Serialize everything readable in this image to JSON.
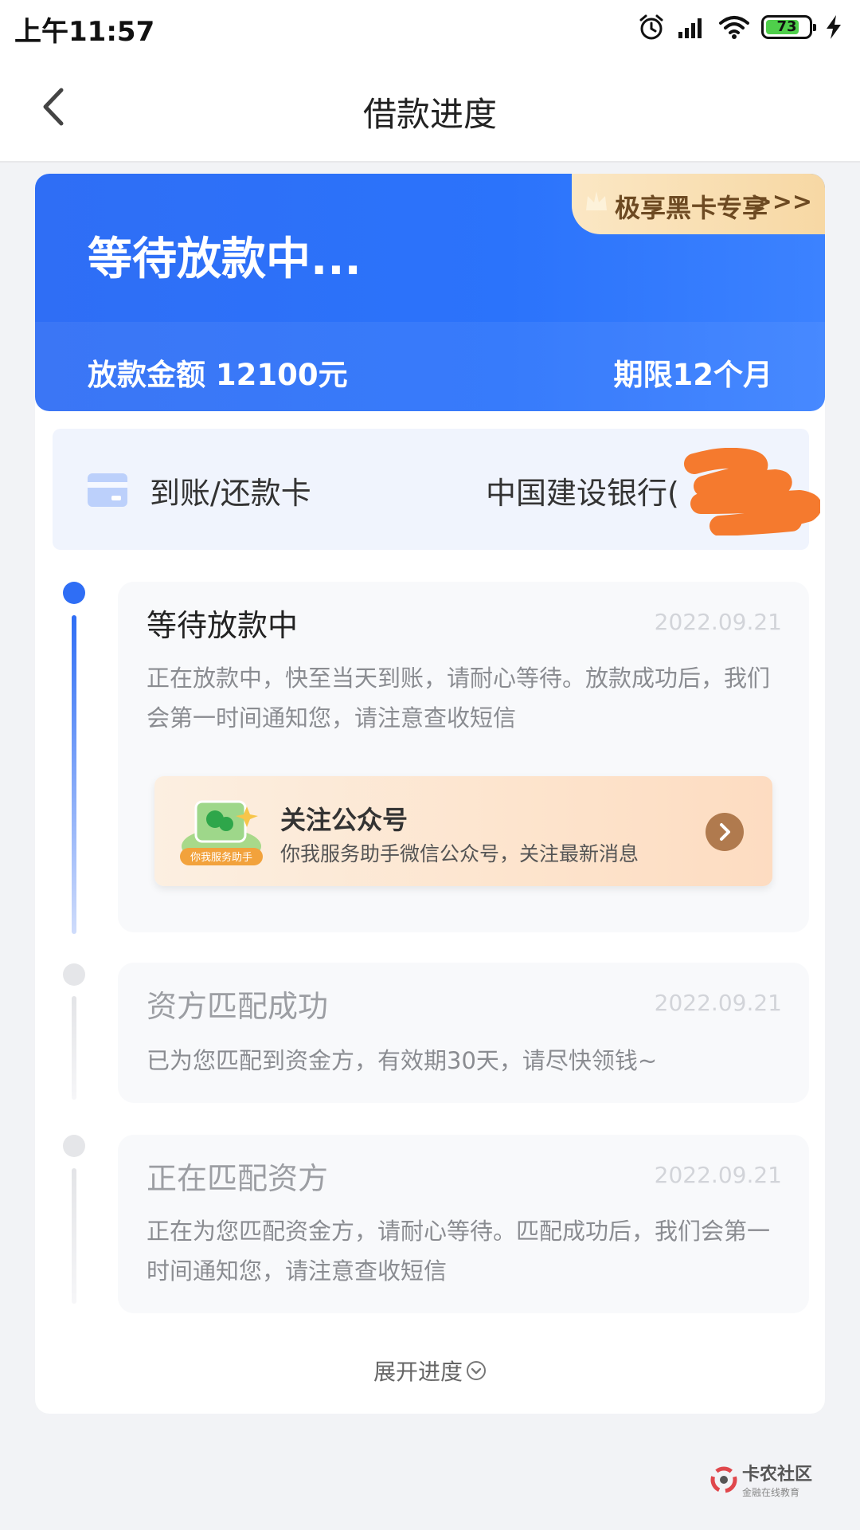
{
  "status_bar": {
    "time": "上午11:57",
    "battery": "73"
  },
  "nav": {
    "title": "借款进度"
  },
  "hero": {
    "status": "等待放款中...",
    "amount_text": "放款金额 12100元",
    "term_text": "期限12个月",
    "vip_tag": "极享黑卡专享",
    "vip_arrows": ">>>"
  },
  "card": {
    "label": "到账/还款卡",
    "bank": "中国建设银行("
  },
  "steps": [
    {
      "title": "等待放款中",
      "date": "2022.09.21",
      "desc": "正在放款中，快至当天到账，请耐心等待。放款成功后，我们会第一时间通知您，请注意查收短信",
      "active": true
    },
    {
      "title": "资方匹配成功",
      "date": "2022.09.21",
      "desc": "已为您匹配到资金方，有效期30天，请尽快领钱~",
      "active": false
    },
    {
      "title": "正在匹配资方",
      "date": "2022.09.21",
      "desc": "正在为您匹配资金方，请耐心等待。匹配成功后，我们会第一时间通知您，请注意查收短信",
      "active": false
    }
  ],
  "promo": {
    "title": "关注公众号",
    "subtitle": "你我服务助手微信公众号，关注最新消息",
    "badge": "你我服务助手"
  },
  "expand_label": "展开进度",
  "watermark": {
    "title": "卡农社区",
    "subtitle": "金融在线教育"
  },
  "colors": {
    "primary": "#2f6ef5",
    "vip_bg": "#f7d8a4",
    "redaction": "#f57a2e"
  }
}
